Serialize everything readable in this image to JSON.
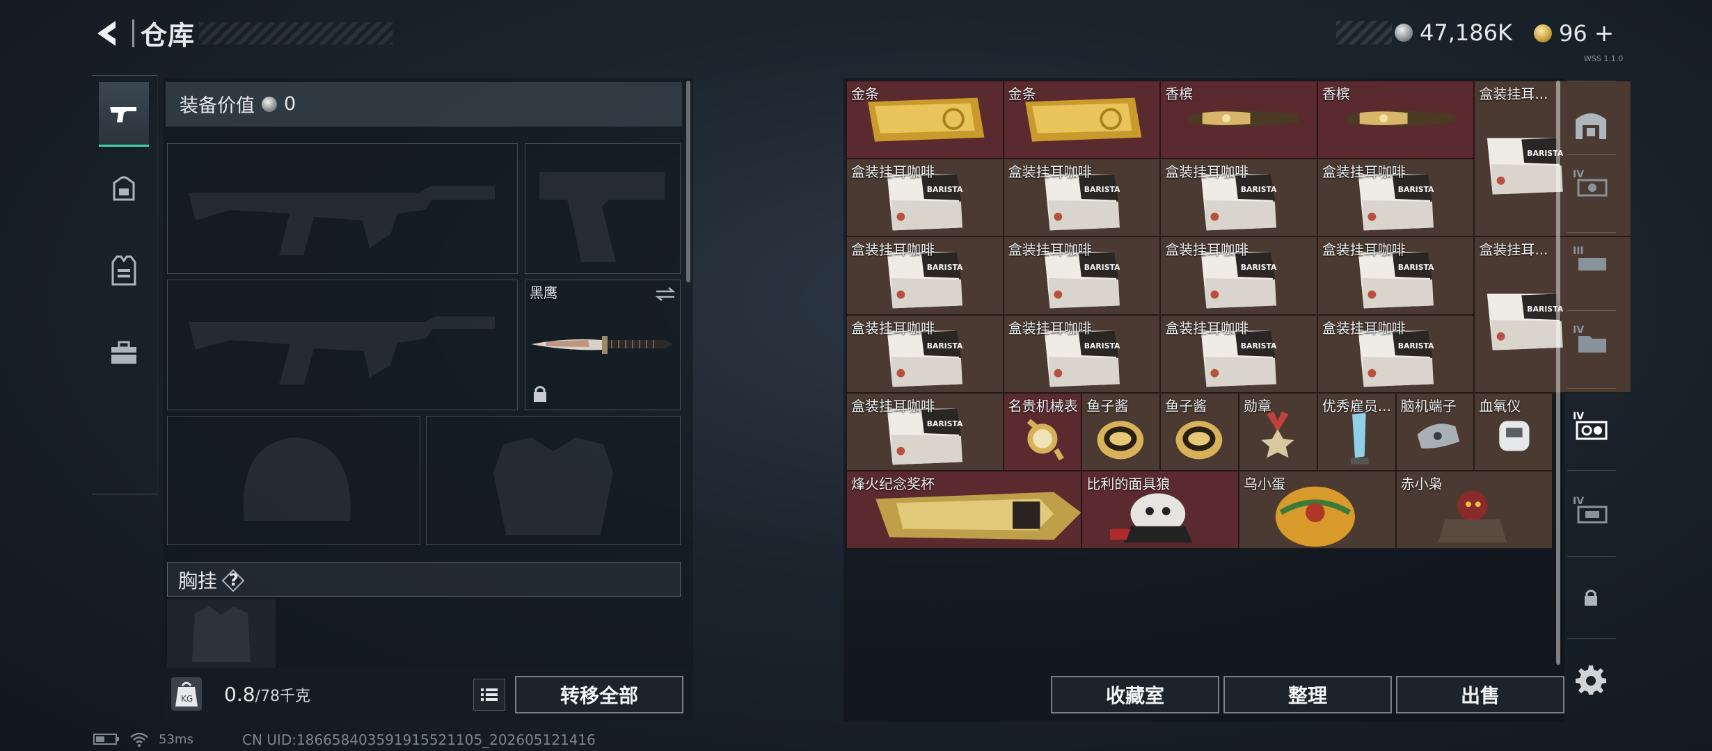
{
  "header": {
    "title": "仓库",
    "silver_amount": "47,186K",
    "gold_amount": "96",
    "gold_plus": "+",
    "tiny_tag": "WSS 1.1.0"
  },
  "left_tabs": [
    "gun-icon",
    "backpack-icon",
    "vest-icon",
    "toolbox-icon"
  ],
  "equipment": {
    "value_label": "装备价值",
    "value_amount": "0",
    "knife_name": "黑鹰",
    "chest_rig_label": "胸挂",
    "help_mark": "?",
    "weight_value": "0.8",
    "weight_max": "/78千克",
    "transfer_all": "转移全部"
  },
  "inventory": {
    "items": [
      {
        "label": "金条",
        "kind": "gold-bar",
        "bg": "red"
      },
      {
        "label": "金条",
        "kind": "gold-bar",
        "bg": "red"
      },
      {
        "label": "香槟",
        "kind": "champagne",
        "bg": "red"
      },
      {
        "label": "香槟",
        "kind": "champagne",
        "bg": "red"
      },
      {
        "label": "盒装挂耳...",
        "kind": "coffee",
        "bg": "brown"
      },
      {
        "label": "盒装挂耳咖啡",
        "kind": "coffee",
        "bg": "brown"
      },
      {
        "label": "盒装挂耳咖啡",
        "kind": "coffee",
        "bg": "brown"
      },
      {
        "label": "盒装挂耳咖啡",
        "kind": "coffee",
        "bg": "brown"
      },
      {
        "label": "盒装挂耳咖啡",
        "kind": "coffee",
        "bg": "brown"
      },
      {
        "label": "盒装挂耳咖啡",
        "kind": "coffee",
        "bg": "brown"
      },
      {
        "label": "盒装挂耳咖啡",
        "kind": "coffee",
        "bg": "brown"
      },
      {
        "label": "盒装挂耳咖啡",
        "kind": "coffee",
        "bg": "brown"
      },
      {
        "label": "盒装挂耳咖啡",
        "kind": "coffee",
        "bg": "brown"
      },
      {
        "label": "盒装挂耳...",
        "kind": "coffee",
        "bg": "brown"
      },
      {
        "label": "盒装挂耳咖啡",
        "kind": "coffee",
        "bg": "brown"
      },
      {
        "label": "盒装挂耳咖啡",
        "kind": "coffee",
        "bg": "brown"
      },
      {
        "label": "盒装挂耳咖啡",
        "kind": "coffee",
        "bg": "brown"
      },
      {
        "label": "盒装挂耳咖啡",
        "kind": "coffee",
        "bg": "brown"
      },
      {
        "label": "盒装挂耳咖啡",
        "kind": "coffee",
        "bg": "brown"
      },
      {
        "label": "名贵机械表",
        "kind": "watch",
        "bg": "red"
      },
      {
        "label": "鱼子酱",
        "kind": "caviar",
        "bg": "brown"
      },
      {
        "label": "鱼子酱",
        "kind": "caviar",
        "bg": "brown"
      },
      {
        "label": "勋章",
        "kind": "medal",
        "bg": "brown"
      },
      {
        "label": "优秀雇员...",
        "kind": "trophy",
        "bg": "brown"
      },
      {
        "label": "脑机端子",
        "kind": "device",
        "bg": "brown"
      },
      {
        "label": "血氧仪",
        "kind": "oximeter",
        "bg": "brown"
      },
      {
        "label": "烽火纪念奖杯",
        "kind": "big-trophy",
        "bg": "red"
      },
      {
        "label": "比利的面具狼",
        "kind": "puppet",
        "bg": "red"
      },
      {
        "label": "乌小蛋",
        "kind": "egg",
        "bg": "brown"
      },
      {
        "label": "赤小枭",
        "kind": "figure",
        "bg": "brown"
      }
    ]
  },
  "actions": {
    "collection": "收藏室",
    "organize": "整理",
    "sell": "出售"
  },
  "right_tabs": [
    "warehouse-icon",
    "storage-IV-icon",
    "storage-III-icon",
    "storage-IV-folder-icon",
    "storage-IV-active-icon",
    "storage-IV-alt-icon",
    "lock-icon"
  ],
  "status": {
    "ping": "53ms",
    "uid": "CN UID:18665840359191552110​5_202605121416"
  },
  "colors": {
    "accent_green": "#3fd3a9",
    "cell_red": "#5a2a2e",
    "cell_brown": "#4b3a32"
  }
}
